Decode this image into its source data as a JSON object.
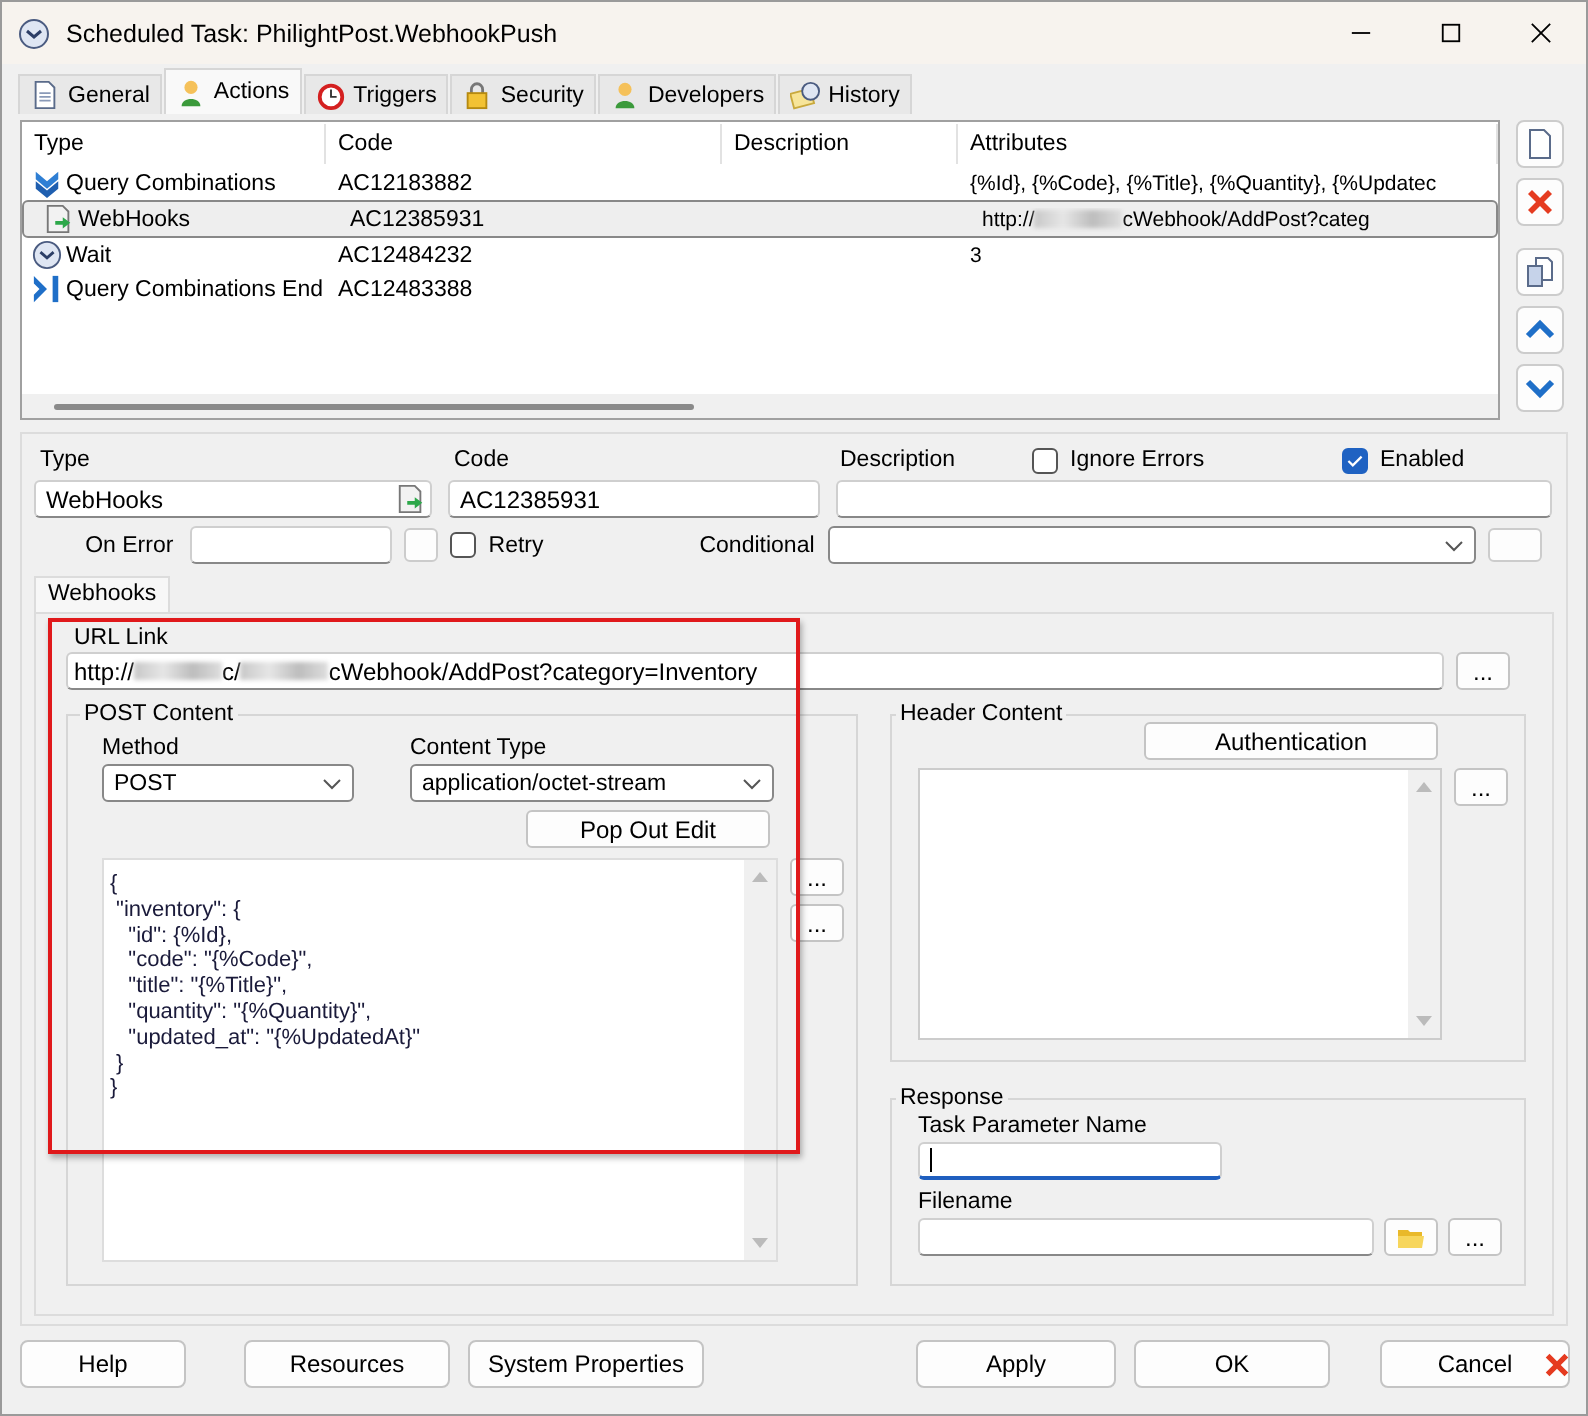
{
  "window": {
    "title": "Scheduled Task: PhilightPost.WebhookPush"
  },
  "tabs": [
    {
      "label": "General",
      "selected": false
    },
    {
      "label": "Actions",
      "selected": true
    },
    {
      "label": "Triggers",
      "selected": false
    },
    {
      "label": "Security",
      "selected": false
    },
    {
      "label": "Developers",
      "selected": false
    },
    {
      "label": "History",
      "selected": false
    }
  ],
  "actions_table": {
    "columns": [
      "Type",
      "Code",
      "Description",
      "Attributes"
    ],
    "rows": [
      {
        "type": "Query Combinations",
        "code": "AC12183882",
        "attributes": [
          {
            "text": "{%Id}, {%Code}, {%Title}, {%Quantity}, {%Updatec"
          }
        ],
        "selected": false
      },
      {
        "type": "WebHooks",
        "code": "AC12385931",
        "attributes": [
          {
            "text": "http://"
          },
          {
            "kind": "redacted"
          },
          {
            "text": "cWebhook/AddPost?categ"
          }
        ],
        "selected": true
      },
      {
        "type": "Wait",
        "code": "AC12484232",
        "attributes": [
          {
            "text": "3"
          }
        ],
        "selected": false
      },
      {
        "type": "Query Combinations End",
        "code": "AC12483388",
        "attributes": [],
        "selected": false
      }
    ]
  },
  "action": {
    "type_label": "Type",
    "type": "WebHooks",
    "code_label": "Code",
    "code": "AC12385931",
    "description_label": "Description",
    "ignore_errors": {
      "label": "Ignore Errors",
      "checked": false
    },
    "enabled": {
      "label": "Enabled",
      "checked": true
    },
    "on_error_label": "On Error",
    "retry": {
      "label": "Retry",
      "checked": false
    },
    "conditional_label": "Conditional"
  },
  "sub_tabs": [
    {
      "label": "Webhooks",
      "selected": true
    }
  ],
  "webhook": {
    "url_label": "URL Link",
    "url_parts": [
      {
        "text": "http://"
      },
      {
        "kind": "redacted"
      },
      {
        "text": "c/"
      },
      {
        "kind": "redacted"
      },
      {
        "text": "cWebhook/AddPost?category=Inventory"
      }
    ],
    "post_group": "POST Content",
    "method_label": "Method",
    "method": "POST",
    "content_type_label": "Content Type",
    "content_type": "application/octet-stream",
    "pop_out_button": "Pop Out Edit",
    "body_lines": [
      "{",
      " \"inventory\": {",
      "   \"id\": {%Id},",
      "   \"code\": \"{%Code}\",",
      "   \"title\": \"{%Title}\",",
      "   \"quantity\": \"{%Quantity}\",",
      "   \"updated_at\": \"{%UpdatedAt}\"",
      " }",
      "}"
    ],
    "header_group": "Header Content",
    "authentication_button": "Authentication",
    "response_group": "Response",
    "task_parameter_label": "Task Parameter Name",
    "task_parameter_focused": true,
    "filename_label": "Filename",
    "ellipsis": "..."
  },
  "footer_buttons": [
    {
      "label": "Help"
    },
    {
      "label": "Resources"
    },
    {
      "label": "System Properties"
    },
    {
      "label": "Apply"
    },
    {
      "label": "OK"
    },
    {
      "label": "Cancel"
    }
  ]
}
